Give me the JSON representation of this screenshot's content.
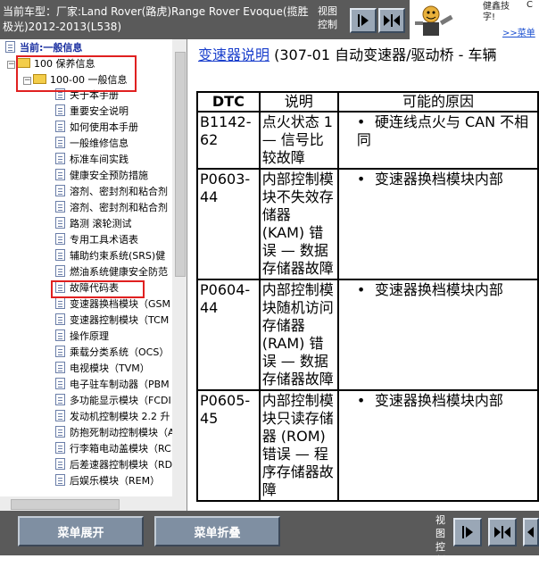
{
  "header": {
    "title": "当前车型：厂家:Land Rover(路虎)Range Rover Evoque(揽胜极光)2012-2013(L538)",
    "view_control_label": "视图控制",
    "nav_buttons": [
      "next-page-icon",
      "first-last-icon"
    ]
  },
  "ad": {
    "text": "健鑫技字!",
    "cut_text": "C",
    "link": ">>菜单"
  },
  "tree": {
    "current_label": "当前:一般信息",
    "root_folder": "100 保养信息",
    "sub_folder": "100-00 一般信息",
    "items": [
      "关于本手册",
      "重要安全说明",
      "如何使用本手册",
      "一般维修信息",
      "标准车间实践",
      "健康安全预防措施",
      "溶剂、密封剂和粘合剂",
      "溶剂、密封剂和粘合剂",
      "路测 滚轮测试",
      "专用工具术语表",
      "辅助约束系统(SRS)健",
      "燃油系统健康安全防范",
      "故障代码表",
      "变速器换档模块（GSM",
      "变速器控制模块（TCM",
      "操作原理",
      "乘载分类系统（OCS）",
      "电视模块（TVM）",
      "电子驻车制动器（PBM",
      "多功能显示模块（FCDI",
      "发动机控制模块 2.2 升",
      "防抱死制动控制模块（A",
      "行李箱电动盖模块（RC",
      "后差速器控制模块（RD",
      "后娱乐模块（REM）"
    ],
    "selected_item": "故障代码表"
  },
  "content": {
    "link_text": "变速器说明",
    "link_suffix": " (307-01 自动变速器/驱动桥 - 车辆",
    "table": {
      "headers": [
        "DTC",
        "说明",
        "可能的原因"
      ],
      "rows": [
        {
          "code": "B1142-62",
          "desc": "点火状态 1 — 信号比较故障",
          "cause": "硬连线点火与 CAN 不相同"
        },
        {
          "code": "P0603-44",
          "desc": "内部控制模块不失效存储器 (KAM) 错误 — 数据存储器故障",
          "cause": "变速器换档模块内部"
        },
        {
          "code": "P0604-44",
          "desc": "内部控制模块随机访问存储器 (RAM) 错误 — 数据存储器故障",
          "cause": "变速器换档模块内部"
        },
        {
          "code": "P0605-45",
          "desc": "内部控制模块只读存储器 (ROM) 错误 — 程序存储器故障",
          "cause": "变速器换档模块内部"
        }
      ]
    }
  },
  "footer": {
    "expand_label": "菜单展开",
    "collapse_label": "菜单折叠",
    "view_control_label": "视图控制"
  },
  "colors": {
    "chrome": "#5a5a5a",
    "button": "#7f8fa2",
    "highlight_box": "#e02020",
    "link": "#1a3fcc",
    "folder": "#f3cd4a"
  }
}
